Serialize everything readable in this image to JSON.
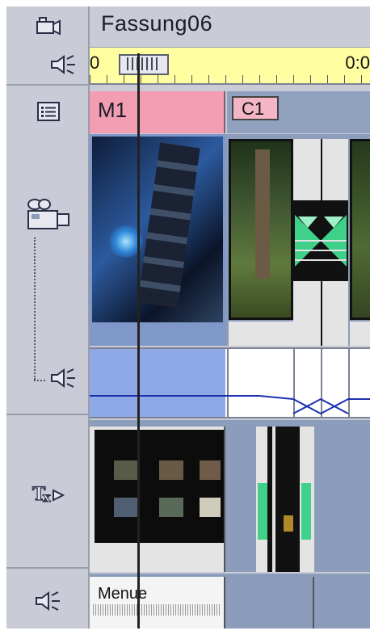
{
  "project": {
    "title": "Fassung06"
  },
  "ruler": {
    "timecode_start": "0",
    "timecode_right": "0:0"
  },
  "chapters": {
    "main_marker": "M1",
    "chapter_marker": "C1"
  },
  "music_track": {
    "clip_label": "Menue"
  },
  "track_headers": [
    {
      "icon": "camera-icon"
    },
    {
      "icon": "speaker-icon"
    },
    {
      "icon": "list-icon"
    },
    {
      "icon": "video-camera-icon"
    },
    {
      "icon": "speaker-icon"
    },
    {
      "icon": "title-icon"
    },
    {
      "icon": "speaker-icon"
    }
  ],
  "colors": {
    "panel": "#c9ccd7",
    "ruler": "#fffea0",
    "menu_marker": "#f39db2",
    "chapter_marker": "#f4b6c6",
    "track": "#8b9dbb",
    "volume_line": "#1d2fb0",
    "transition_green": "#3fd08a"
  }
}
